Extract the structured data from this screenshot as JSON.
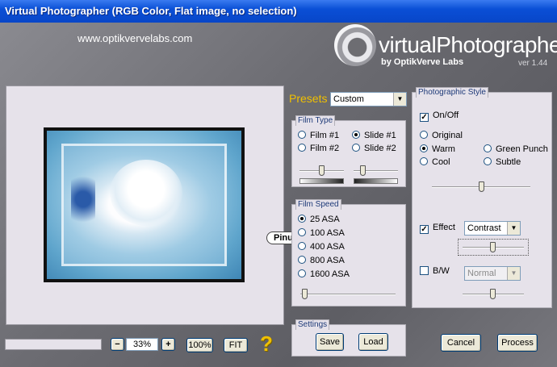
{
  "window": {
    "title": "Virtual Photographer (RGB Color, Flat image, no selection)"
  },
  "header": {
    "url": "www.optikvervelabs.com",
    "logo_text": "virtualPhotographer",
    "logo_sub": "by OptikVerve Labs",
    "version": "ver 1.44"
  },
  "preview": {
    "watermark": "Pinuccia"
  },
  "zoom": {
    "minus": "−",
    "value": "33%",
    "plus": "+",
    "hundred": "100%",
    "fit": "FIT",
    "help": "?"
  },
  "presets": {
    "label": "Presets",
    "value": "Custom"
  },
  "film_type": {
    "title": "Film Type",
    "options": [
      {
        "label": "Film #1",
        "checked": false
      },
      {
        "label": "Slide #1",
        "checked": true
      },
      {
        "label": "Film #2",
        "checked": false
      },
      {
        "label": "Slide #2",
        "checked": false
      }
    ]
  },
  "film_speed": {
    "title": "Film Speed",
    "options": [
      {
        "label": "25 ASA",
        "checked": true
      },
      {
        "label": "100 ASA",
        "checked": false
      },
      {
        "label": "400 ASA",
        "checked": false
      },
      {
        "label": "800 ASA",
        "checked": false
      },
      {
        "label": "1600 ASA",
        "checked": false
      }
    ]
  },
  "settings": {
    "title": "Settings",
    "save": "Save",
    "load": "Load"
  },
  "photographic_style": {
    "title": "Photographic Style",
    "onoff": "On/Off",
    "onoff_checked": true,
    "styles": [
      {
        "label": "Original",
        "checked": false
      },
      {
        "label": "Warm",
        "checked": true
      },
      {
        "label": "Green Punch",
        "checked": false
      },
      {
        "label": "Cool",
        "checked": false
      },
      {
        "label": "Subtle",
        "checked": false
      }
    ],
    "effect_label": "Effect",
    "effect_checked": true,
    "effect_value": "Contrast",
    "bw_label": "B/W",
    "bw_checked": false,
    "bw_value": "Normal"
  },
  "actions": {
    "cancel": "Cancel",
    "process": "Process"
  },
  "colors": {
    "title_bar": "#0a4fd6",
    "accent": "#f0c000",
    "group_bg": "#e6e2ea"
  }
}
